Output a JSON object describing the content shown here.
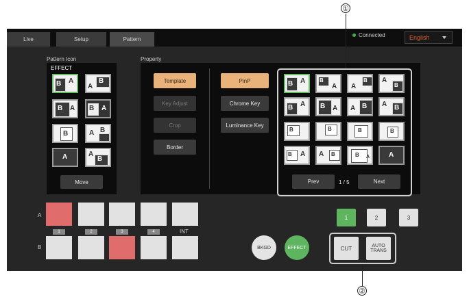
{
  "tabs": [
    {
      "label": "Live"
    },
    {
      "label": "Setup"
    },
    {
      "label": "Pattern"
    }
  ],
  "status": {
    "connected": "Connected"
  },
  "language": {
    "selected": "English"
  },
  "pattern_icon": {
    "title": "Pattern Icon",
    "subtitle": "EFFECT",
    "move_label": "Move"
  },
  "property": {
    "title": "Property",
    "categories": [
      "Template",
      "Key Adjust",
      "Crop",
      "Border"
    ],
    "types": [
      "PinP",
      "Chrome Key",
      "Luminance Key"
    ],
    "prev_label": "Prev",
    "page": "1 / 5",
    "next_label": "Next"
  },
  "icon_letters": {
    "a": "A",
    "b": "B"
  },
  "rows": {
    "a": "A",
    "b": "B"
  },
  "bus_numbers": [
    "1",
    "2",
    "3",
    "4",
    "INT"
  ],
  "pages": [
    "1",
    "2",
    "3"
  ],
  "actions": {
    "bkgd": "BKGD",
    "effect": "EFFECT",
    "cut": "CUT",
    "auto_trans": "AUTO\nTRANS"
  },
  "callouts": [
    "①",
    "②"
  ],
  "colors": {
    "selected_green": "#6dbb6d",
    "accent_orange": "#e8b27a",
    "active_red": "#e06c6c",
    "effect_green": "#5fb55f",
    "lang_text": "#d95a2b"
  }
}
